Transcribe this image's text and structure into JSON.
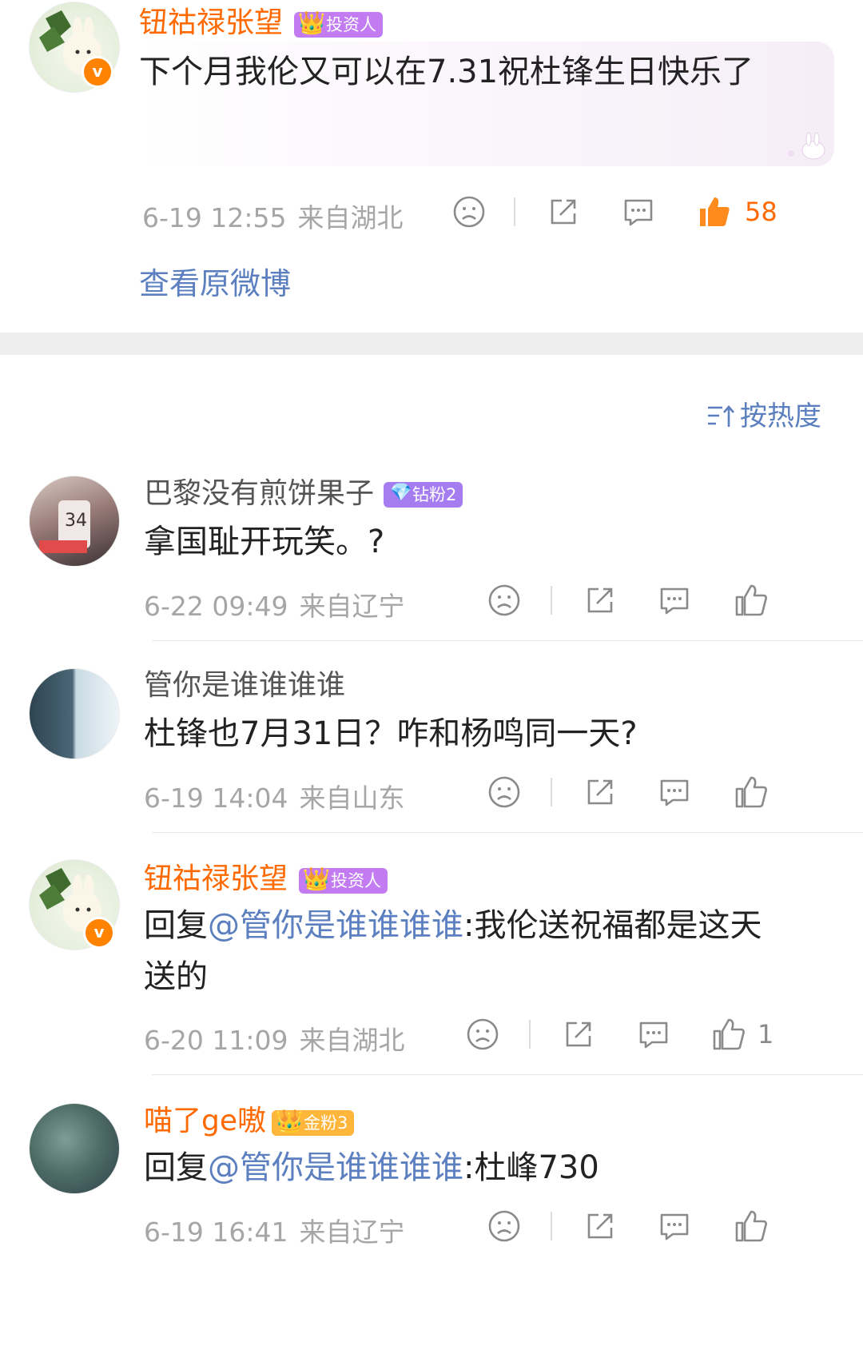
{
  "main_post": {
    "user": "钮祜禄张望",
    "badge": "投资人",
    "verified_mark": "v",
    "text": "下个月我伦又可以在7.31祝杜锋生日快乐了",
    "date": "6-19 12:55",
    "location": "来自湖北",
    "like_count": "58",
    "view_original": "查看原微博"
  },
  "sort": {
    "icon": "sort-icon",
    "label": "按热度"
  },
  "comments": [
    {
      "user": "巴黎没有煎饼果子",
      "badge": "钻粉2",
      "text": "拿国耻开玩笑。?",
      "date": "6-22 09:49",
      "location": "来自辽宁",
      "like_count": ""
    },
    {
      "user": "管你是谁谁谁谁",
      "badge": "",
      "text": "杜锋也7月31日？咋和杨鸣同一天?",
      "date": "6-19 14:04",
      "location": "来自山东",
      "like_count": ""
    },
    {
      "user": "钮祜禄张望",
      "badge": "投资人",
      "verified_mark": "v",
      "reply_prefix": "回复",
      "mention": "@管你是谁谁谁谁",
      "text": ":我伦送祝福都是这天送的",
      "date": "6-20 11:09",
      "location": "来自湖北",
      "like_count": "1"
    },
    {
      "user": "喵了ge嗷",
      "badge": "金粉3",
      "reply_prefix": "回复",
      "mention": "@管你是谁谁谁谁",
      "text": ":杜峰730",
      "date": "6-19 16:41",
      "location": "来自辽宁",
      "like_count": ""
    }
  ],
  "icons": {
    "dislike": "sad-face-icon",
    "share": "share-icon",
    "comment": "comment-icon",
    "like": "thumbs-up-icon"
  },
  "colors": {
    "username_orange": "#ff6a00",
    "link_blue": "#5b7fbf",
    "liked_orange": "#ff6a00",
    "meta_gray": "#a6a6a6"
  }
}
